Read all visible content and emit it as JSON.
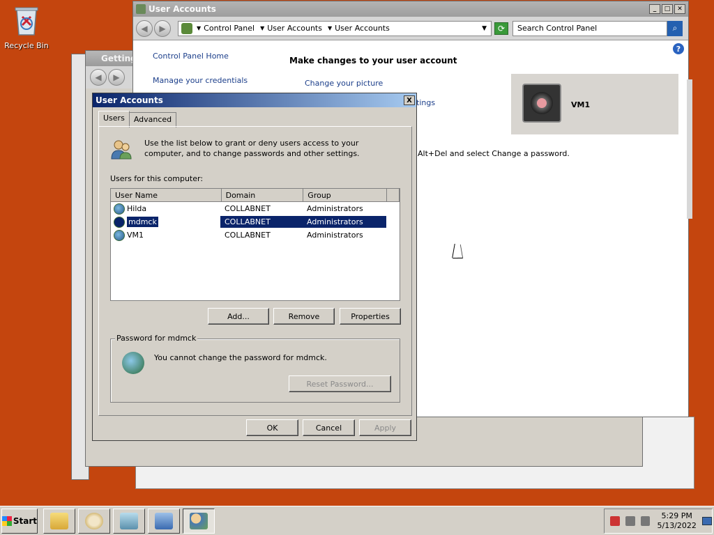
{
  "desktop": {
    "recycle_bin_label": "Recycle Bin"
  },
  "getting_started_window": {
    "title": "Getting"
  },
  "control_panel_window": {
    "title": "User Accounts",
    "breadcrumbs": [
      "Control Panel",
      "User Accounts",
      "User Accounts"
    ],
    "search_placeholder": "Search Control Panel",
    "nav_links": [
      "Control Panel Home",
      "Manage your credentials"
    ],
    "heading": "Make changes to your user account",
    "task_links": [
      "Change your picture"
    ],
    "partial_text_1": "tings",
    "partial_text_2": "Alt+Del and select Change a password.",
    "user_tile_name": "VM1"
  },
  "dialog": {
    "title": "User Accounts",
    "close_label": "X",
    "tabs": [
      "Users",
      "Advanced"
    ],
    "selected_tab": "Users",
    "intro_text": "Use the list below to grant or deny users access to your computer, and to change passwords and other settings.",
    "users_label": "Users for this computer:",
    "columns": [
      "User Name",
      "Domain",
      "Group"
    ],
    "users": [
      {
        "name": "Hilda",
        "domain": "COLLABNET",
        "group": "Administrators",
        "selected": false
      },
      {
        "name": "mdmck",
        "domain": "COLLABNET",
        "group": "Administrators",
        "selected": true
      },
      {
        "name": "VM1",
        "domain": "COLLABNET",
        "group": "Administrators",
        "selected": false
      }
    ],
    "add_label": "Add...",
    "remove_label": "Remove",
    "properties_label": "Properties",
    "password_group_title": "Password for mdmck",
    "password_text": "You cannot change the password for mdmck.",
    "reset_password_label": "Reset Password...",
    "ok_label": "OK",
    "cancel_label": "Cancel",
    "apply_label": "Apply"
  },
  "taskbar": {
    "start_label": "Start",
    "time": "5:29 PM",
    "date": "5/13/2022",
    "buttons": [
      "explorer-icon",
      "paint-icon",
      "notepad-icon",
      "control-panel-icon",
      "user-accounts-icon"
    ]
  },
  "colors": {
    "desktop": "#c4450e",
    "selection": "#0a246a",
    "link": "#1b3e8a"
  }
}
